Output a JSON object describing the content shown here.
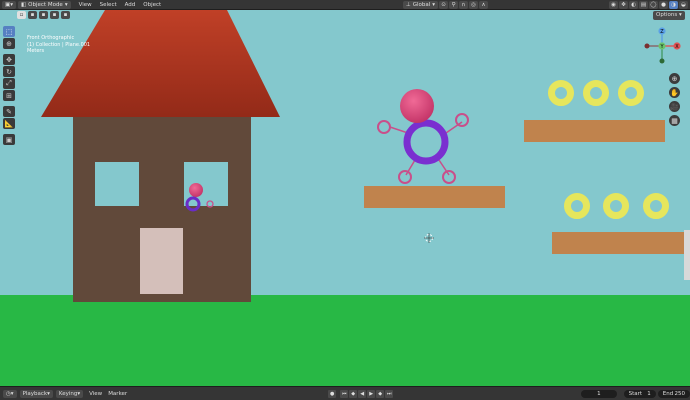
{
  "header": {
    "editor_icon": "3d-viewport-icon",
    "mode": "Object Mode",
    "menus": [
      "View",
      "Select",
      "Add",
      "Object"
    ],
    "orientation": "Global",
    "options": "Options"
  },
  "overlay": {
    "view_name": "Front Orthographic",
    "collection": "(1) Collection | Plane.001",
    "units": "Meters"
  },
  "gizmo": {
    "y": "Y",
    "x": "X",
    "z": "Z"
  },
  "timeline": {
    "playback": "Playback",
    "keying": "Keying",
    "view": "View",
    "marker": "Marker",
    "current_frame": "1",
    "start_label": "Start",
    "start_value": "1",
    "end_label": "End",
    "end_value": "250"
  },
  "colors": {
    "sky": "#84c8cd",
    "ground": "#28b845",
    "roof": "#a8341f",
    "house_wall": "#61493a",
    "door": "#d4bfba",
    "platform": "#c0834d",
    "ring_purple": "#7a2fd0",
    "ball_pink": "#e0487a",
    "donut_yellow": "#e6e65c",
    "accent": "#5680c2"
  }
}
